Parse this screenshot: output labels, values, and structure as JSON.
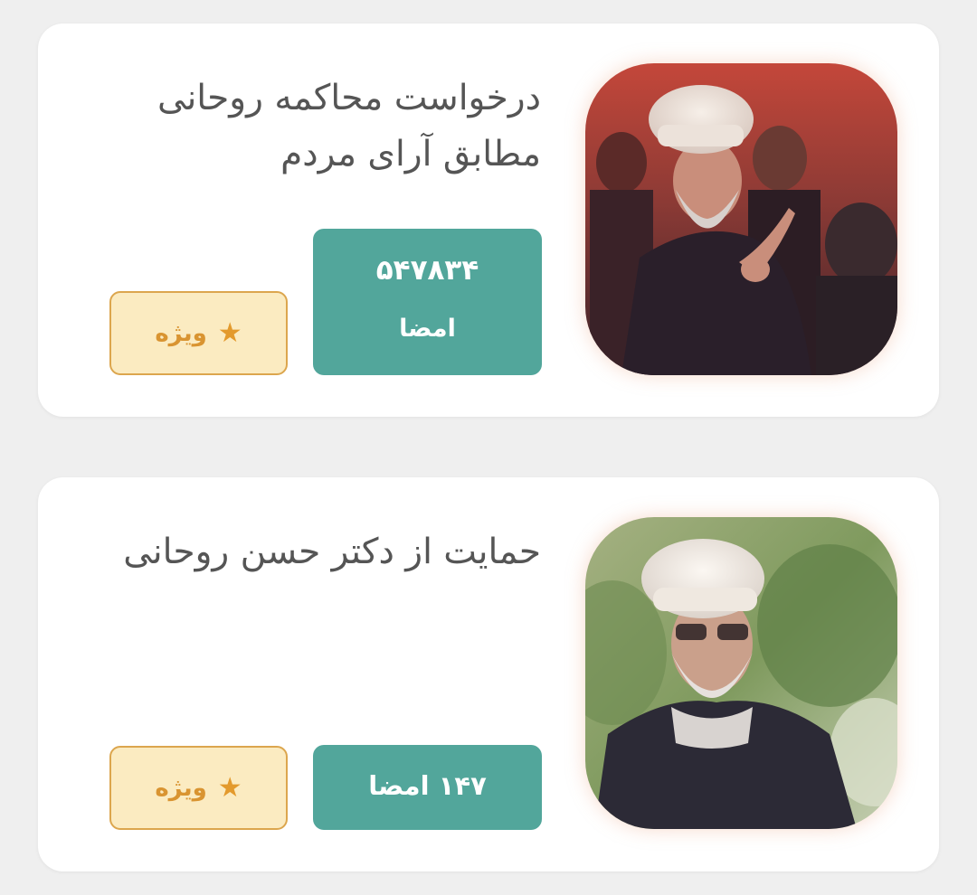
{
  "petitions": [
    {
      "title": "درخواست محاکمه روحانی\nمطابق آرای مردم",
      "signature_count": "۵۴۷۸۳۴",
      "signature_label": "امضا",
      "badge_label": "ویژه",
      "badge_icon": "star-icon"
    },
    {
      "title": "حمایت از دکتر حسن روحانی",
      "signature_text": "۱۴۷ امضا",
      "badge_label": "ویژه",
      "badge_icon": "star-icon"
    }
  ],
  "colors": {
    "background": "#efefef",
    "card": "#ffffff",
    "signature_box": "#52a69b",
    "badge_bg": "#fbebc1",
    "badge_border": "#dca64e",
    "badge_text": "#d99431",
    "title_text": "#555555"
  }
}
